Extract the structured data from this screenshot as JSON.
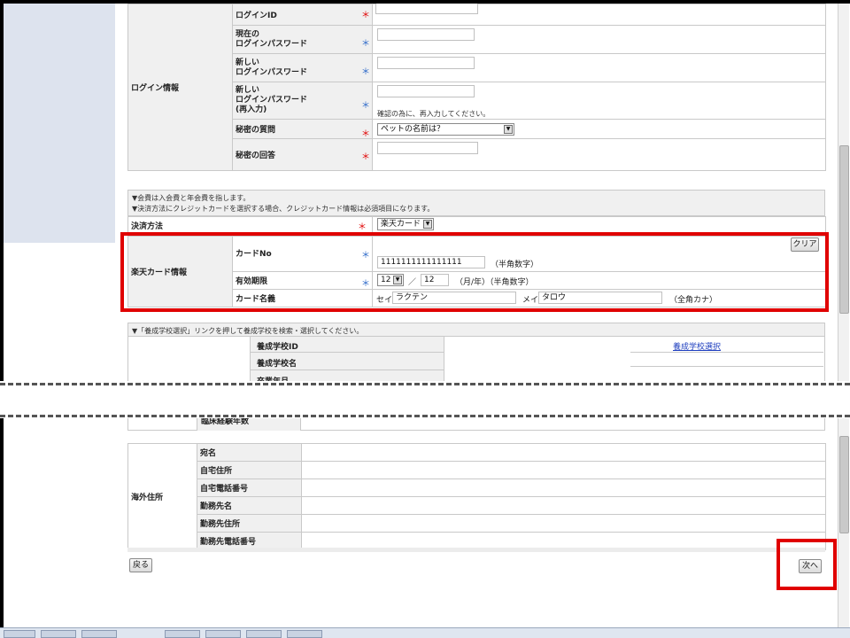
{
  "login_section": {
    "group_label": "ログイン情報",
    "rows": [
      {
        "label": "ログインID",
        "req": "＊"
      },
      {
        "label": "現在の\nログインパスワード",
        "req": "＊"
      },
      {
        "label": "新しい\nログインパスワード",
        "req": "＊"
      },
      {
        "label": "新しい\nログインパスワード\n(再入力)",
        "req": "＊",
        "note": "確認の為に、再入力してください。"
      },
      {
        "label": "秘密の質問",
        "req": "＊"
      },
      {
        "label": "秘密の回答",
        "req": "＊"
      }
    ],
    "secret_question_value": "ペットの名前は？"
  },
  "payment_section": {
    "notice_line1": "▼会費は入会費と年会費を指します。",
    "notice_line2": "▼決済方法にクレジットカードを選択する場合、クレジットカード情報は必須項目になります。",
    "method_label": "決済方法",
    "method_value": "楽天カード",
    "req": "＊"
  },
  "card_section": {
    "group_label": "楽天カード情報",
    "clear_button": "クリア",
    "card_no_label": "カードNo",
    "card_no_value": "1111111111111111",
    "card_no_hint": "（半角数字）",
    "expiry_label": "有効期限",
    "expiry_month": "12",
    "expiry_sep": "／",
    "expiry_year": "12",
    "expiry_hint": "（月/年）（半角数字）",
    "name_label": "カード名義",
    "sei_label": "セイ",
    "sei_value": "ラクテン",
    "mei_label": "メイ",
    "mei_value": "タロウ",
    "name_hint": "（全角カナ）",
    "req": "＊"
  },
  "school_section": {
    "notice": "▼「養成学校選択」リンクを押して養成学校を検索・選択してください。",
    "rows": [
      "養成学校ID",
      "養成学校名",
      "卒業年月"
    ],
    "select_link": "養成学校選択",
    "partial_label": "臨床経験年数"
  },
  "overseas_section": {
    "group_label": "海外住所",
    "rows": [
      "宛名",
      "自宅住所",
      "自宅電話番号",
      "勤務先名",
      "勤務先住所",
      "勤務先電話番号"
    ]
  },
  "footer": {
    "back_button": "戻る",
    "next_button": "次へ"
  }
}
